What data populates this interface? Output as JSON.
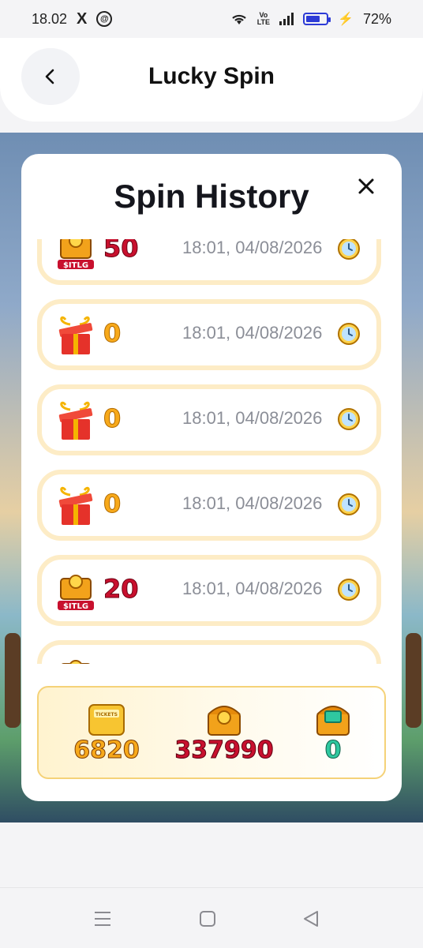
{
  "status_bar": {
    "time": "18.02",
    "x_logo": "X",
    "app_icon": "@",
    "volte": "Vo LTE",
    "battery": "72%",
    "battery_level": 0.72
  },
  "header": {
    "title": "Lucky Spin",
    "back_icon": "back-arrow-icon"
  },
  "modal": {
    "title": "Spin History",
    "close_icon": "close-icon",
    "items": [
      {
        "icon": "itlg-chest-icon",
        "amount": "50",
        "time": "18:01, 04/08/2026"
      },
      {
        "icon": "gift-box-icon",
        "amount": "0",
        "time": "18:01, 04/08/2026"
      },
      {
        "icon": "gift-box-icon",
        "amount": "0",
        "time": "18:01, 04/08/2026"
      },
      {
        "icon": "gift-box-icon",
        "amount": "0",
        "time": "18:01, 04/08/2026"
      },
      {
        "icon": "itlg-chest-icon",
        "amount": "20",
        "time": "18:01, 04/08/2026"
      },
      {
        "icon": "itlg-chest-icon",
        "amount": "",
        "time": ""
      }
    ],
    "balances": {
      "tickets": "6820",
      "coins": "337990",
      "gems": "0"
    }
  },
  "colors": {
    "accent_red": "#c8102e",
    "accent_gold": "#f7a91b",
    "item_border": "#fdecc6"
  }
}
